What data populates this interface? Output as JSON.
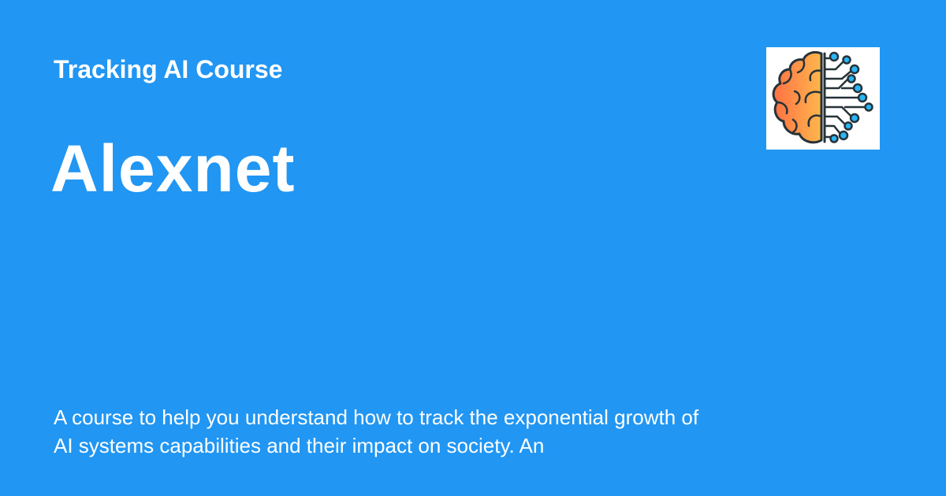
{
  "course": {
    "name": "Tracking AI Course"
  },
  "page": {
    "title": "Alexnet"
  },
  "description": "A course to help you understand how to track the exponential growth of AI systems capabilities and their impact on society.  An",
  "logo": {
    "icon": "brain-circuit-icon"
  },
  "colors": {
    "background": "#2196F3",
    "text": "#ffffff",
    "brain_left": "#FF7043",
    "brain_right": "#FFB74D",
    "circuit": "#29B6F6",
    "outline": "#263238"
  }
}
